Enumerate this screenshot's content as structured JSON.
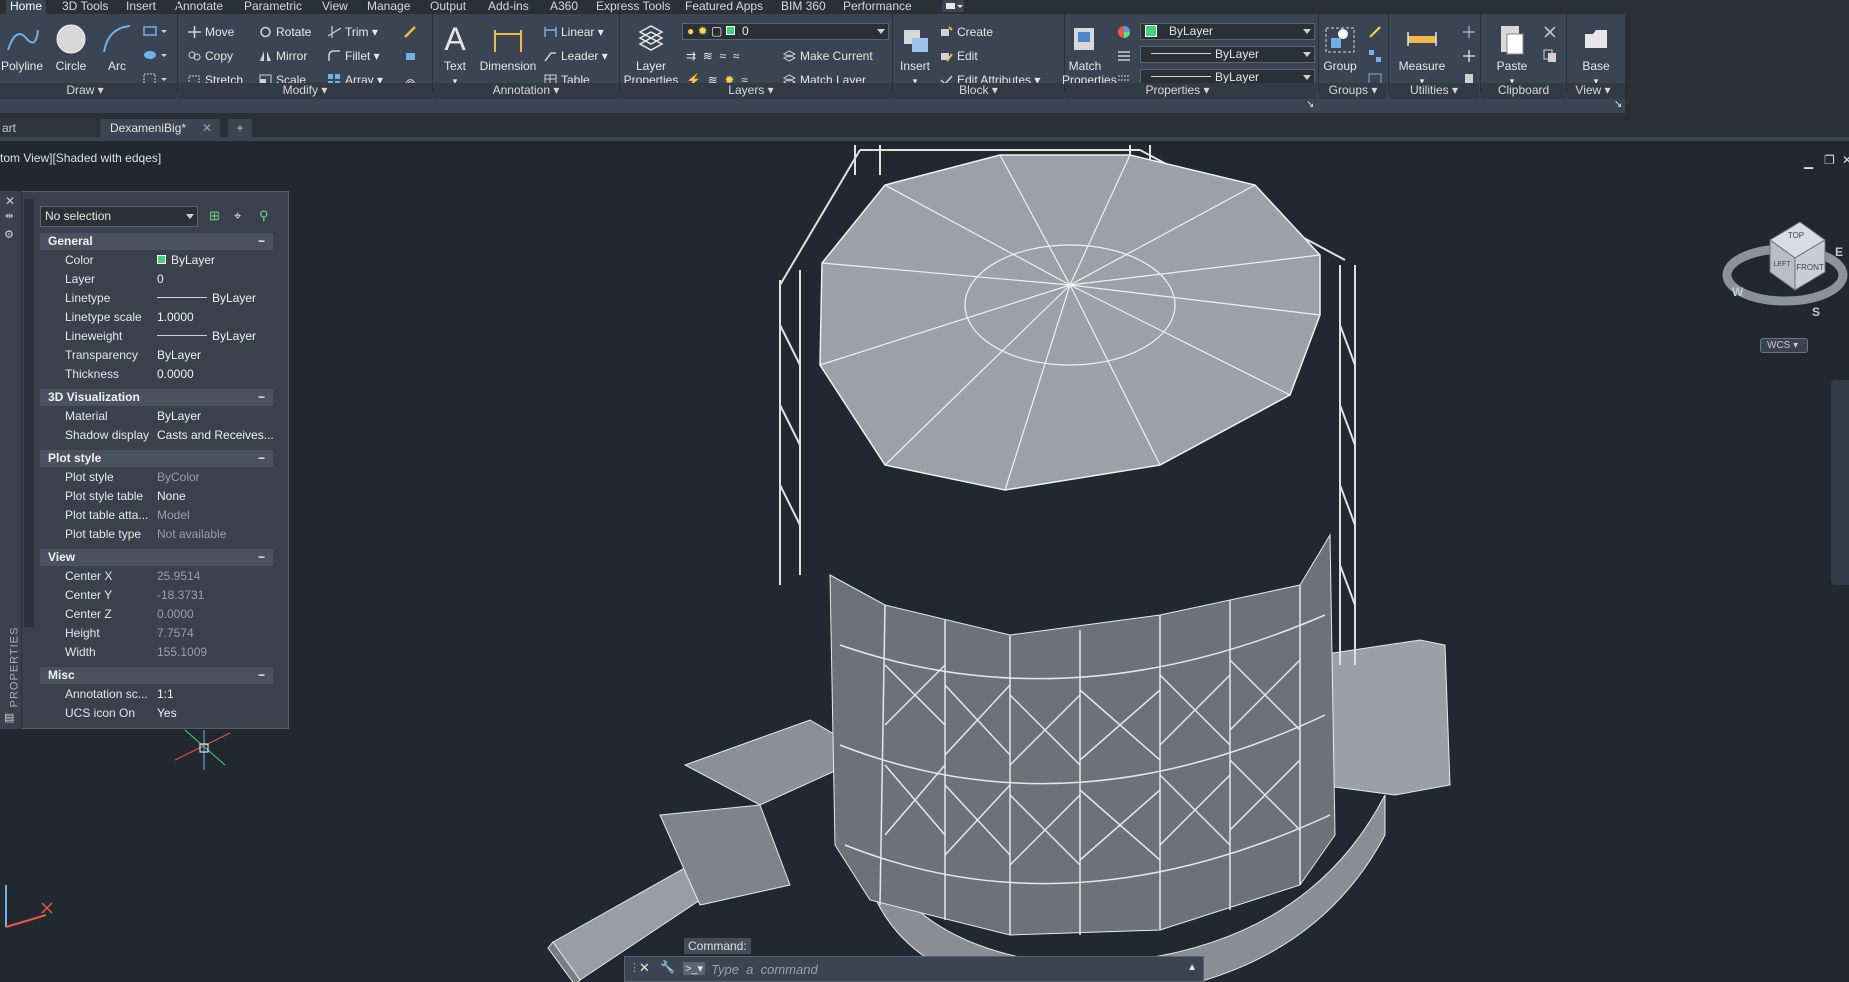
{
  "menu": {
    "tabs": [
      "Home",
      "3D Tools",
      "Insert",
      "Annotate",
      "Parametric",
      "View",
      "Manage",
      "Output",
      "Add-ins",
      "A360",
      "Express Tools",
      "Featured Apps",
      "BIM 360",
      "Performance"
    ],
    "extra_icon": "toggle-ribbon-icon"
  },
  "ribbon": {
    "draw": {
      "title": "Draw",
      "polyline": "Polyline",
      "circle": "Circle",
      "arc": "Arc"
    },
    "modify": {
      "title": "Modify",
      "move": "Move",
      "rotate": "Rotate",
      "trim": "Trim",
      "copy": "Copy",
      "mirror": "Mirror",
      "fillet": "Fillet",
      "stretch": "Stretch",
      "scale": "Scale",
      "array": "Array"
    },
    "annotation": {
      "title": "Annotation",
      "text": "Text",
      "dimension": "Dimension",
      "linear": "Linear",
      "leader": "Leader",
      "table": "Table"
    },
    "layers": {
      "title": "Layers",
      "layer_properties_1": "Layer",
      "layer_properties_2": "Properties",
      "current_layer": "0",
      "make_current": "Make Current",
      "match_layer": "Match Layer"
    },
    "block": {
      "title": "Block",
      "insert": "Insert",
      "create": "Create",
      "edit": "Edit",
      "edit_attributes": "Edit Attributes"
    },
    "properties": {
      "title": "Properties",
      "match_1": "Match",
      "match_2": "Properties",
      "color": "ByLayer",
      "linetype": "ByLayer",
      "lineweight": "ByLayer",
      "color_swatch": "#3fd37a"
    },
    "groups": {
      "title": "Groups",
      "group": "Group"
    },
    "utilities": {
      "title": "Utilities",
      "measure": "Measure"
    },
    "clipboard": {
      "title": "Clipboard",
      "paste": "Paste"
    },
    "view": {
      "title": "View",
      "base": "Base"
    }
  },
  "filetabs": {
    "start_tab": "art",
    "drawing_tab": "DexameniBig*",
    "new_tab": "+"
  },
  "viewport": {
    "label": "tom View][Shaded with edqes]",
    "wcs": "WCS"
  },
  "viewcube": {
    "top": "TOP",
    "front": "FRONT",
    "left": "LEFT",
    "north": "W",
    "east": "E",
    "south": "S"
  },
  "properties_palette": {
    "side_label": "PROPERTIES",
    "selection": "No selection",
    "sections": {
      "general": "General",
      "viz3d": "3D Visualization",
      "plotstyle": "Plot style",
      "view": "View",
      "misc": "Misc"
    },
    "general": [
      {
        "k": "Color",
        "v": "ByLayer"
      },
      {
        "k": "Layer",
        "v": "0"
      },
      {
        "k": "Linetype",
        "v": "ByLayer"
      },
      {
        "k": "Linetype scale",
        "v": "1.0000"
      },
      {
        "k": "Lineweight",
        "v": "ByLayer"
      },
      {
        "k": "Transparency",
        "v": "ByLayer"
      },
      {
        "k": "Thickness",
        "v": "0.0000"
      }
    ],
    "viz3d": [
      {
        "k": "Material",
        "v": "ByLayer"
      },
      {
        "k": "Shadow display",
        "v": "Casts  and  Receives..."
      }
    ],
    "plotstyle": [
      {
        "k": "Plot style",
        "v": "ByColor"
      },
      {
        "k": "Plot style table",
        "v": "None"
      },
      {
        "k": "Plot table atta...",
        "v": "Model"
      },
      {
        "k": "Plot table type",
        "v": "Not available"
      }
    ],
    "view": [
      {
        "k": "Center X",
        "v": "25.9514"
      },
      {
        "k": "Center Y",
        "v": "-18.3731"
      },
      {
        "k": "Center Z",
        "v": "0.0000"
      },
      {
        "k": "Height",
        "v": "7.7574"
      },
      {
        "k": "Width",
        "v": "155.1009"
      }
    ],
    "misc": [
      {
        "k": "Annotation sc...",
        "v": "1:1"
      },
      {
        "k": "UCS icon On",
        "v": "Yes"
      }
    ]
  },
  "command": {
    "label": "Command:",
    "placeholder": "Type  a  command"
  }
}
